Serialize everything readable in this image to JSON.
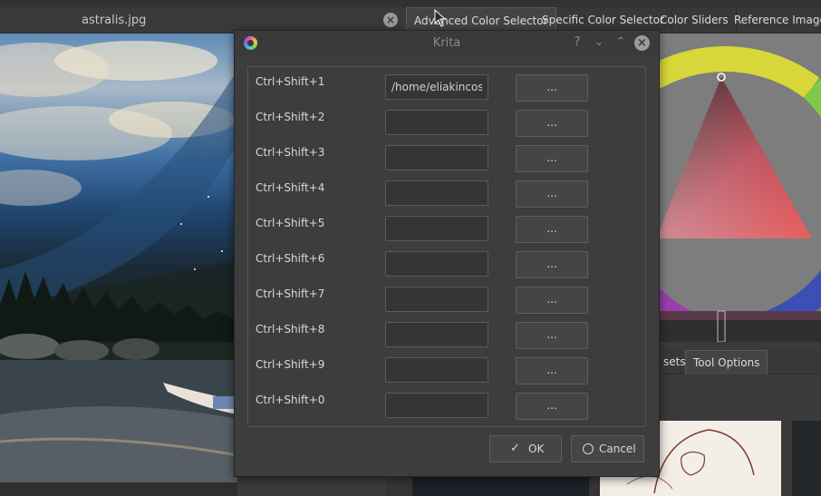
{
  "document_tab": {
    "title": "astralis.jpg",
    "close_icon": "close-icon"
  },
  "panel_tabs": [
    {
      "label": "Advanced Color Selector"
    },
    {
      "label": "Specific Color Selector"
    },
    {
      "label": "Color Sliders"
    },
    {
      "label": "Reference Images"
    }
  ],
  "dock_subtabs": [
    {
      "label": "sets"
    },
    {
      "label": "Tool Options"
    }
  ],
  "dialog": {
    "title": "Krita",
    "help_glyph": "?",
    "minimize_glyph": "⌄",
    "maximize_glyph": "⌃",
    "close_glyph": "×",
    "browse_label": "...",
    "rows": [
      {
        "shortcut": "Ctrl+Shift+1",
        "path": "/home/eliakincosta"
      },
      {
        "shortcut": "Ctrl+Shift+2",
        "path": ""
      },
      {
        "shortcut": "Ctrl+Shift+3",
        "path": ""
      },
      {
        "shortcut": "Ctrl+Shift+4",
        "path": ""
      },
      {
        "shortcut": "Ctrl+Shift+5",
        "path": ""
      },
      {
        "shortcut": "Ctrl+Shift+6",
        "path": ""
      },
      {
        "shortcut": "Ctrl+Shift+7",
        "path": ""
      },
      {
        "shortcut": "Ctrl+Shift+8",
        "path": ""
      },
      {
        "shortcut": "Ctrl+Shift+9",
        "path": ""
      },
      {
        "shortcut": "Ctrl+Shift+0",
        "path": ""
      }
    ],
    "ok_label": "OK",
    "ok_icon": "✓",
    "cancel_label": "Cancel",
    "cancel_icon": "⃠"
  },
  "colors": {
    "background": "#3b3b3b",
    "dialog_bg": "#3d3d3d",
    "field_bg": "#353535",
    "text": "#d8d8d8",
    "title_text": "#8c8c8c",
    "color_selector_bg": "#7d7d7d"
  }
}
